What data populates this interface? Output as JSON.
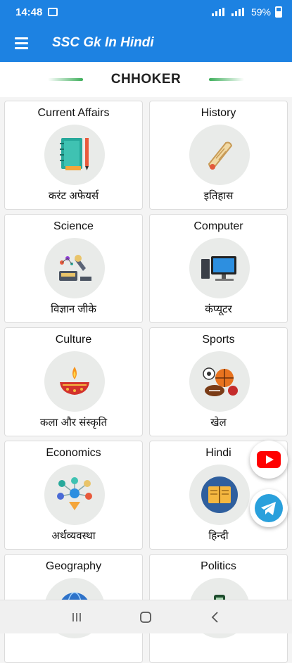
{
  "status": {
    "time": "14:48",
    "battery": "59%"
  },
  "appbar": {
    "title": "SSC Gk In Hindi"
  },
  "banner": {
    "brand": "CHHOKER"
  },
  "categories": [
    {
      "en": "Current Affairs",
      "hi": "करंट अफेयर्स",
      "icon": "notebook-icon"
    },
    {
      "en": "History",
      "hi": "इतिहास",
      "icon": "scroll-icon"
    },
    {
      "en": "Science",
      "hi": "विज्ञान जीके",
      "icon": "microscope-icon"
    },
    {
      "en": "Computer",
      "hi": "कंप्यूटर",
      "icon": "computer-icon"
    },
    {
      "en": "Culture",
      "hi": "कला और संस्कृति",
      "icon": "diya-icon"
    },
    {
      "en": "Sports",
      "hi": "खेल",
      "icon": "sports-balls-icon"
    },
    {
      "en": "Economics",
      "hi": "अर्थव्यवस्था",
      "icon": "economy-icon"
    },
    {
      "en": "Hindi",
      "hi": "हिन्दी",
      "icon": "book-icon"
    },
    {
      "en": "Geography",
      "hi": "",
      "icon": "globe-icon"
    },
    {
      "en": "Politics",
      "hi": "",
      "icon": "politics-icon"
    }
  ],
  "fabs": {
    "youtube": "youtube-icon",
    "telegram": "telegram-icon"
  }
}
